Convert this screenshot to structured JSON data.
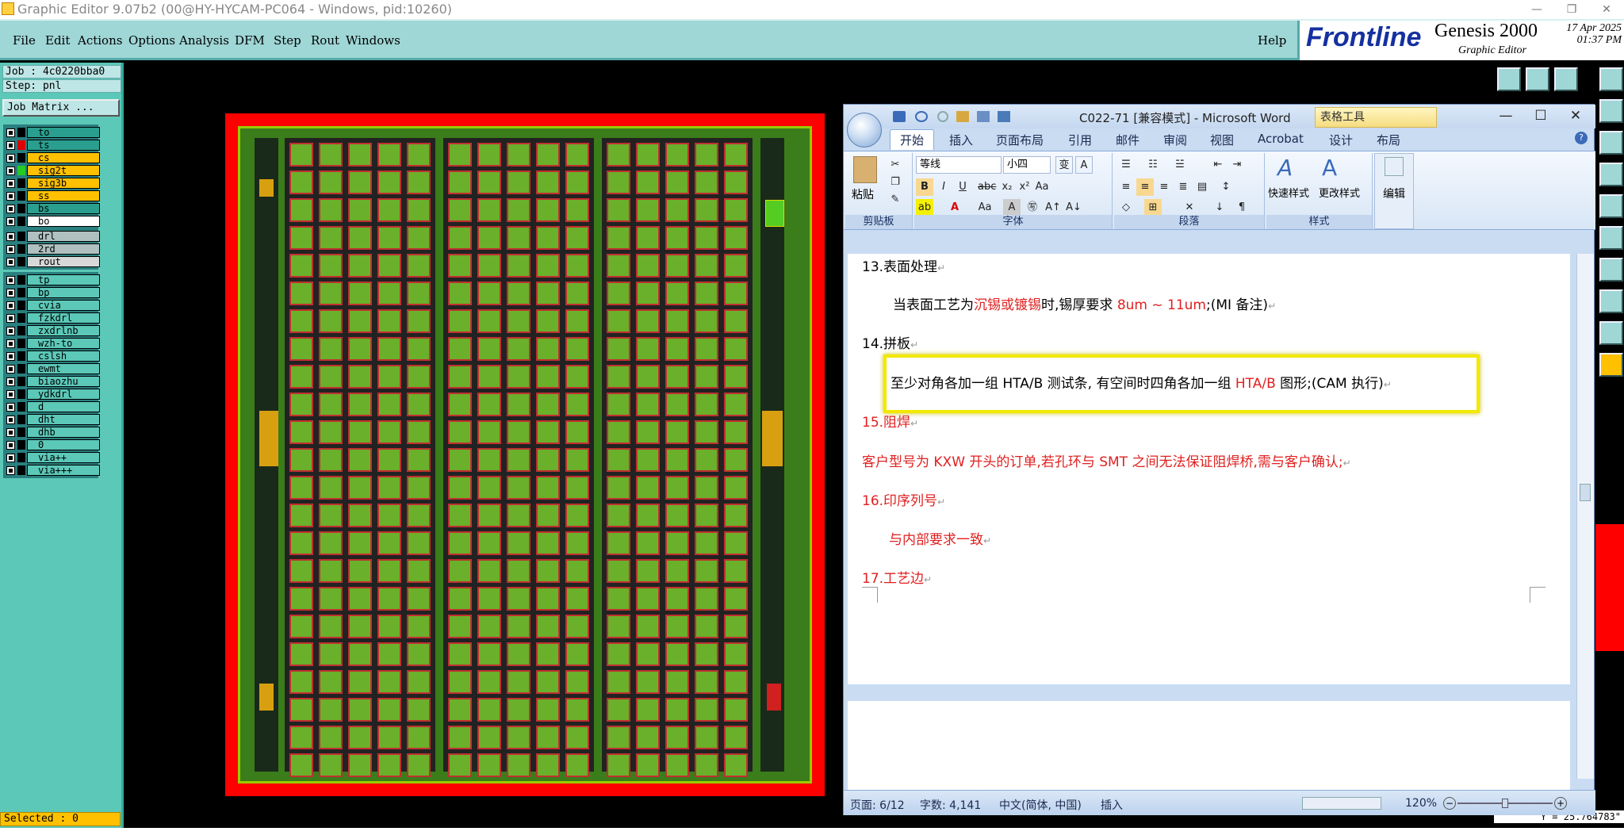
{
  "window": {
    "title": "Graphic Editor 9.07b2 (00@HY-HYCAM-PC064 - Windows, pid:10260)",
    "buttons": {
      "minimize": "—",
      "restore": "❐",
      "close": "✕"
    }
  },
  "menubar": {
    "items": [
      "File",
      "Edit",
      "Actions",
      "Options",
      "Analysis",
      "DFM",
      "Step",
      "Rout",
      "Windows"
    ],
    "help": "Help"
  },
  "logo": {
    "brand": "Frontline",
    "product": "Genesis 2000",
    "subtitle": "Graphic Editor",
    "date": "17 Apr 2025",
    "time": "01:37 PM"
  },
  "leftpanel": {
    "job": "Job : 4c0220bba0",
    "step": "Step: pnl",
    "job_matrix": "Job Matrix ...",
    "board_layers": [
      {
        "name": "to",
        "color": "#2a9f8f"
      },
      {
        "name": "ts",
        "color": "#2a9f8f"
      },
      {
        "name": "cs",
        "color": "#ffc000"
      },
      {
        "name": "sig2t",
        "color": "#ffc000"
      },
      {
        "name": "sig3b",
        "color": "#ffc000"
      },
      {
        "name": "ss",
        "color": "#ffc000"
      },
      {
        "name": "bs",
        "color": "#2a9f8f"
      },
      {
        "name": "bo",
        "color": "#ffffff"
      }
    ],
    "drill_layers": [
      {
        "name": "drl",
        "color": "#b0c0c0"
      },
      {
        "name": "2rd",
        "color": "#b0c0c0"
      },
      {
        "name": "rout",
        "color": "#d8d8d8"
      }
    ],
    "misc_layers": [
      "tp",
      "bp",
      "cvia",
      "fzkdrl",
      "zxdrlnb",
      "wzh-to",
      "cslsh",
      "ewmt",
      "biaozhu",
      "ydkdrl",
      "d",
      "dht",
      "dhb",
      "0",
      "via++",
      "via+++"
    ],
    "selected": "Selected : 0"
  },
  "coords": {
    "y": "Y = 25.764783\""
  },
  "word": {
    "title": "C022-71 [兼容模式] - Microsoft Word",
    "contextual_tab": "表格工具",
    "tabs": [
      "开始",
      "插入",
      "页面布局",
      "引用",
      "邮件",
      "审阅",
      "视图",
      "Acrobat",
      "设计",
      "布局"
    ],
    "ribbon": {
      "clipboard": {
        "paste": "粘贴",
        "label": "剪贴板"
      },
      "font": {
        "family": "等线",
        "size": "小四",
        "label": "字体"
      },
      "paragraph": {
        "label": "段落"
      },
      "styles": {
        "quick": "快速样式",
        "change": "更改样式",
        "label": "样式"
      },
      "edit": {
        "label": "编辑"
      }
    },
    "doc": {
      "s13_heading": "13.表面处理",
      "s13_pre": "当表面工艺为",
      "s13_red1": "沉锡或镀锡",
      "s13_mid": "时,锡厚要求 ",
      "s13_red2": "8um ~ 11um",
      "s13_post": ";(MI 备注)",
      "s14_heading": "14.拼板",
      "s14_pre": "至少对角各加一组 HTA/B 测试条, 有空间时四角各加一组 ",
      "s14_red": "HTA/B",
      "s14_post": " 图形;(CAM 执行)",
      "s15_heading": "15.阻焊",
      "s15_body": "客户型号为 KXW 开头的订单,若孔环与 SMT 之间无法保证阻焊桥,需与客户确认;",
      "s16_heading": "16.印序列号",
      "s16_body": "与内部要求一致",
      "s17_heading": "17.工艺边",
      "para_mark": "↵"
    },
    "status": {
      "page": "页面: 6/12",
      "words": "字数: 4,141",
      "lang": "中文(简体, 中国)",
      "mode": "插入",
      "zoom": "120%"
    }
  }
}
